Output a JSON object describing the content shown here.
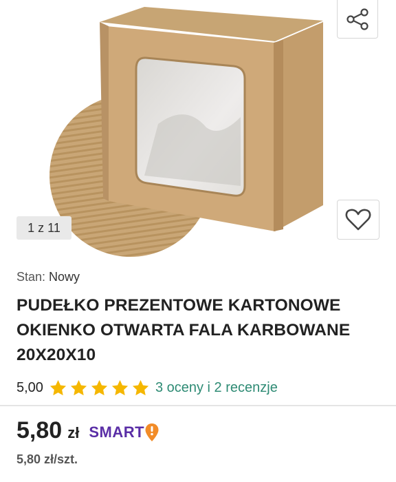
{
  "gallery": {
    "counter": "1 z 11",
    "image_alt": "product-photo"
  },
  "icons": {
    "share": "share-icon",
    "favorite": "heart-icon",
    "star": "star-icon",
    "smart": "smart-exclamation-icon"
  },
  "product": {
    "condition_label": "Stan:",
    "condition_value": "Nowy",
    "title": "PUDEŁKO PREZENTOWE KARTONOWE OKIENKO OTWARTA FALA KARBOWANE 20X20X10",
    "rating_value": "5,00",
    "rating_stars": 5,
    "reviews_link": "3 oceny i 2 recenzje",
    "price_main": "5,80",
    "price_currency": "zł",
    "smart_label": "SMART",
    "unit_price": "5,80 zł/szt."
  },
  "colors": {
    "star": "#f5b700",
    "link": "#2e8b74",
    "smart_purple": "#5a2ea6",
    "smart_orange": "#f28c28"
  }
}
